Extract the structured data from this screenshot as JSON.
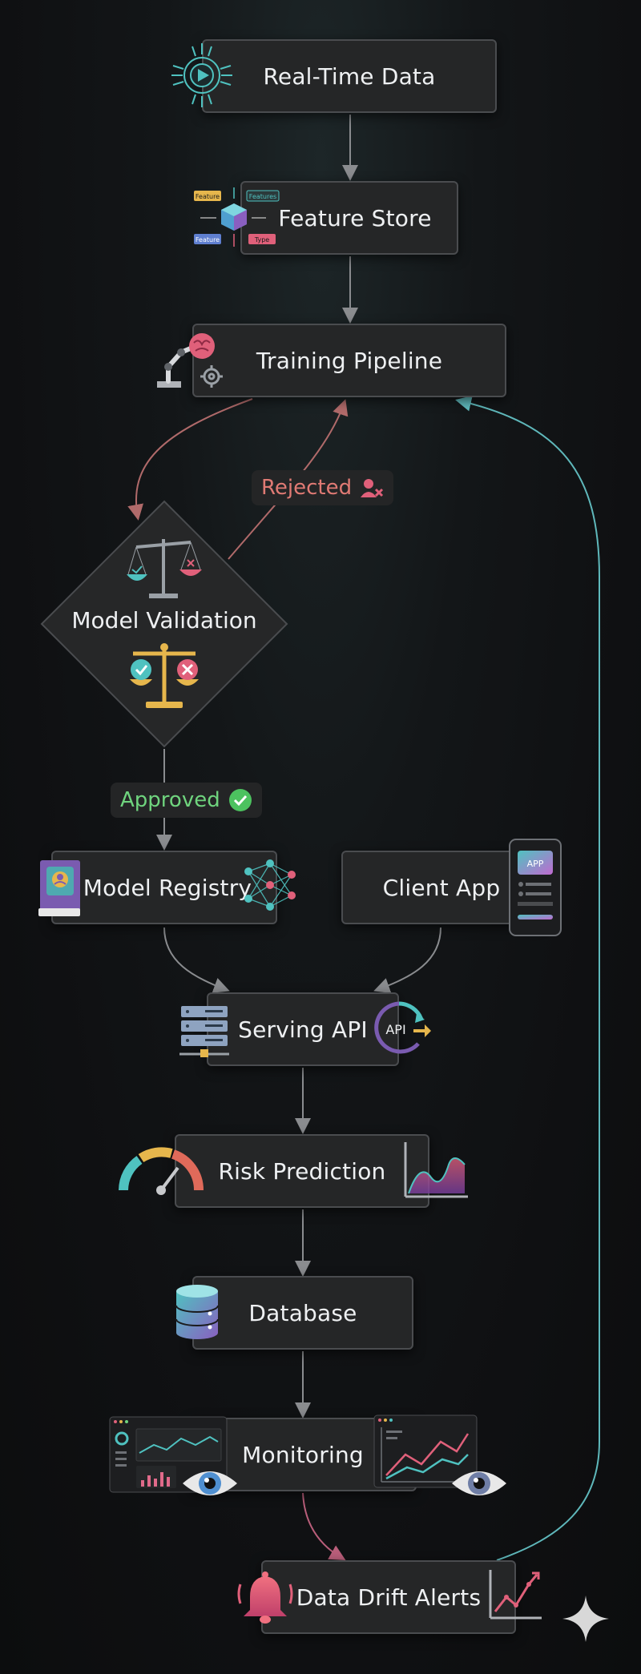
{
  "nodes": {
    "realtime_data": "Real-Time Data",
    "feature_store": "Feature Store",
    "training_pipeline": "Training Pipeline",
    "model_validation": "Model Validation",
    "model_registry": "Model Registry",
    "client_app": "Client App",
    "serving_api": "Serving API",
    "risk_prediction": "Risk Prediction",
    "database": "Database",
    "monitoring": "Monitoring",
    "data_drift_alerts": "Data Drift Alerts"
  },
  "edge_labels": {
    "rejected": "Rejected",
    "approved": "Approved"
  },
  "icon_text": {
    "feature_tag": "Feature",
    "features_tag": "Features",
    "type_tag": "Type",
    "app_badge": "APP",
    "api_badge": "API"
  },
  "colors": {
    "node_bg": "#252627",
    "node_border": "#4a4c4f",
    "arrow_gray": "#8a8c8f",
    "rejected_arrow": "#b06a6a",
    "rejected_text": "#e07a74",
    "approved_text": "#6fd47e",
    "retrain_arrow": "#5fb8bb",
    "monitor_arrow": "#b95e7a",
    "accent_teal": "#52c7c4",
    "accent_pink": "#e0607a"
  }
}
